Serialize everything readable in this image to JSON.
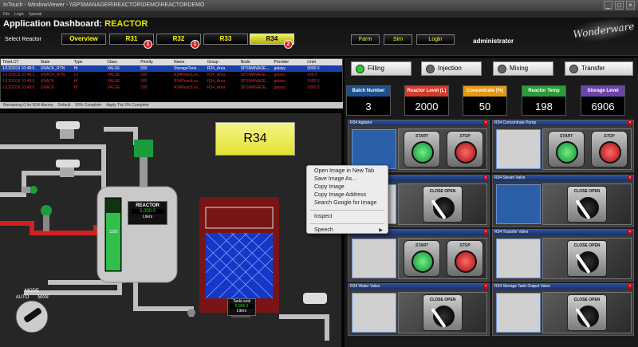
{
  "window": {
    "title": "InTouch - WindowViewer - \\\\SPSMANAGER\\REACTOR\\DEMO\\REACTORDEMO",
    "controls": [
      "_",
      "□",
      "×"
    ]
  },
  "menubar": {
    "items": [
      "File",
      "Logic",
      "Special"
    ]
  },
  "header": {
    "title_prefix": "Application Dashboard:",
    "title_accent": "REACTOR",
    "select_label": "Select Reactor",
    "reactor_buttons": [
      {
        "label": "Overview",
        "badge": ""
      },
      {
        "label": "R31",
        "badge": "1"
      },
      {
        "label": "R32",
        "badge": "1"
      },
      {
        "label": "R33",
        "badge": ""
      },
      {
        "label": "R34",
        "badge": "2"
      }
    ],
    "nav_buttons": [
      "Farm",
      "Sim",
      "Login"
    ],
    "user": "administrator",
    "logo": "Wonderware"
  },
  "alarms": {
    "columns": [
      "TimeLCT",
      "State",
      "Type",
      "Class",
      "Priority",
      "Name",
      "Group",
      "Node",
      "Provider",
      "Limit"
    ],
    "rows": [
      [
        "1/13/2019 10:48:0..",
        "UNACK_RTN",
        "Hi",
        "VALUE",
        "500",
        "StorageTank...",
        "R34_Area",
        "SPSMANAGE...",
        "galaxy",
        "9000.0"
      ],
      [
        "1/13/2019 10:48:2..",
        "UNACK_RTN",
        "Lo",
        "VALUE",
        "500",
        "R34ReactLev...",
        "R34_Area",
        "SPSMANAGE...",
        "galaxy",
        "500.0"
      ],
      [
        "1/13/2019 10:48:0..",
        "UNACK",
        "Hi",
        "VALUE",
        "500",
        "R34ReactLev...",
        "R34_Area",
        "SPSMANAGE...",
        "galaxy",
        "1600.0"
      ],
      [
        "1/13/2019 10:48:0..",
        "UNACK",
        "Hi",
        "VALUE",
        "500",
        "R34ReactLev...",
        "R34_Area",
        "SPSMANAGE...",
        "galaxy",
        "1800.0"
      ]
    ],
    "footer": [
      "Remaining 0 for R34 Alarms",
      "Default",
      "50% Complete",
      "Apply Ttol 0% Complete"
    ]
  },
  "process": {
    "reactor_label": "R34",
    "reactor_name": "REACTOR",
    "reactor_value": "2,000.0",
    "reactor_unit": "Liters",
    "level_tick": "1100",
    "tank_label": "TankLevel",
    "tank_value": "6,906.0",
    "tank_unit": "Liters",
    "mode_label": "MODE",
    "mode_auto": "AUTO",
    "mode_man": "MAN"
  },
  "modes": [
    {
      "label": "Filling",
      "active": true
    },
    {
      "label": "Injection",
      "active": false
    },
    {
      "label": "Mixing",
      "active": false
    },
    {
      "label": "Transfer",
      "active": false
    }
  ],
  "kpis": [
    {
      "label": "Batch Number",
      "value": "3",
      "color": "#1c4f8c"
    },
    {
      "label": "Reactor Level (L)",
      "value": "2000",
      "color": "#d63a2a"
    },
    {
      "label": "Concentrate (%)",
      "value": "50",
      "color": "#e39a10"
    },
    {
      "label": "Reactor Temp",
      "value": "198",
      "color": "#2c9b3a"
    },
    {
      "label": "Storage Level",
      "value": "6906",
      "color": "#6a45a8"
    }
  ],
  "cards": [
    {
      "title": "R34 Agitator",
      "type": "startstop"
    },
    {
      "title": "R34 Concentrate Pump",
      "type": "startstop"
    },
    {
      "title": "R34 Valve",
      "type": "knob"
    },
    {
      "title": "R34 Steam Valve",
      "type": "knob"
    },
    {
      "title": "R34 Pump",
      "type": "startstop"
    },
    {
      "title": "R34 Transfer Valve",
      "type": "knob"
    },
    {
      "title": "R34 Water Valve",
      "type": "knob"
    },
    {
      "title": "R34 Storage Tank Output Valve",
      "type": "knob"
    }
  ],
  "control_labels": {
    "start": "START",
    "stop": "STOP",
    "close": "CLOSE",
    "open": "OPEN"
  },
  "context_menu": {
    "items": [
      "Open Image in New Tab",
      "Save Image As...",
      "Copy Image",
      "Copy Image Address",
      "Search Google for Image"
    ],
    "inspect": "Inspect",
    "speech": "Speech"
  }
}
